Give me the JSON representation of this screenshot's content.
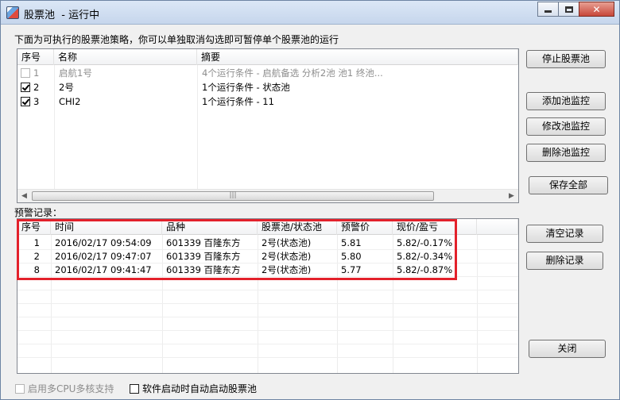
{
  "window": {
    "title": "股票池  - 运行中",
    "minimize_label": "",
    "close_label": "✕"
  },
  "instruction": "下面为可执行的股票池策略，你可以单独取消勾选即可暂停单个股票池的运行",
  "pool_table": {
    "columns": [
      "序号",
      "名称",
      "摘要"
    ],
    "rows": [
      {
        "num": "1",
        "name": "启航1号",
        "summary": "4个运行条件 - 启航备选 分析2池 池1 终池...",
        "checked": false,
        "disabled": true
      },
      {
        "num": "2",
        "name": "2号",
        "summary": "1个运行条件 - 状态池",
        "checked": true,
        "disabled": false
      },
      {
        "num": "3",
        "name": "CHI2",
        "summary": "1个运行条件 - 11",
        "checked": true,
        "disabled": false
      }
    ],
    "scroll_grip": "|||"
  },
  "alerts_label": "预警记录：",
  "alerts_table": {
    "columns": [
      "序号",
      "时间",
      "品种",
      "股票池/状态池",
      "预警价",
      "现价/盈亏"
    ],
    "rows": [
      {
        "num": "1",
        "time": "2016/02/17 09:54:09",
        "stock": "601339 百隆东方",
        "pool": "2号(状态池)",
        "price": "5.81",
        "current": "5.82/-0.17%"
      },
      {
        "num": "2",
        "time": "2016/02/17 09:47:07",
        "stock": "601339 百隆东方",
        "pool": "2号(状态池)",
        "price": "5.80",
        "current": "5.82/-0.34%"
      },
      {
        "num": "8",
        "time": "2016/02/17 09:41:47",
        "stock": "601339 百隆东方",
        "pool": "2号(状态池)",
        "price": "5.77",
        "current": "5.82/-0.87%"
      }
    ]
  },
  "buttons": {
    "stop_pool": "停止股票池",
    "add_monitor": "添加池监控",
    "edit_monitor": "修改池监控",
    "delete_monitor": "删除池监控",
    "save_all": "保存全部",
    "clear_records": "清空记录",
    "delete_record": "删除记录",
    "close": "关闭"
  },
  "options": {
    "multi_cpu": "启用多CPU多核支持",
    "auto_start": "软件启动时自动启动股票池"
  },
  "colors": {
    "highlight_box": "#e3212b"
  }
}
